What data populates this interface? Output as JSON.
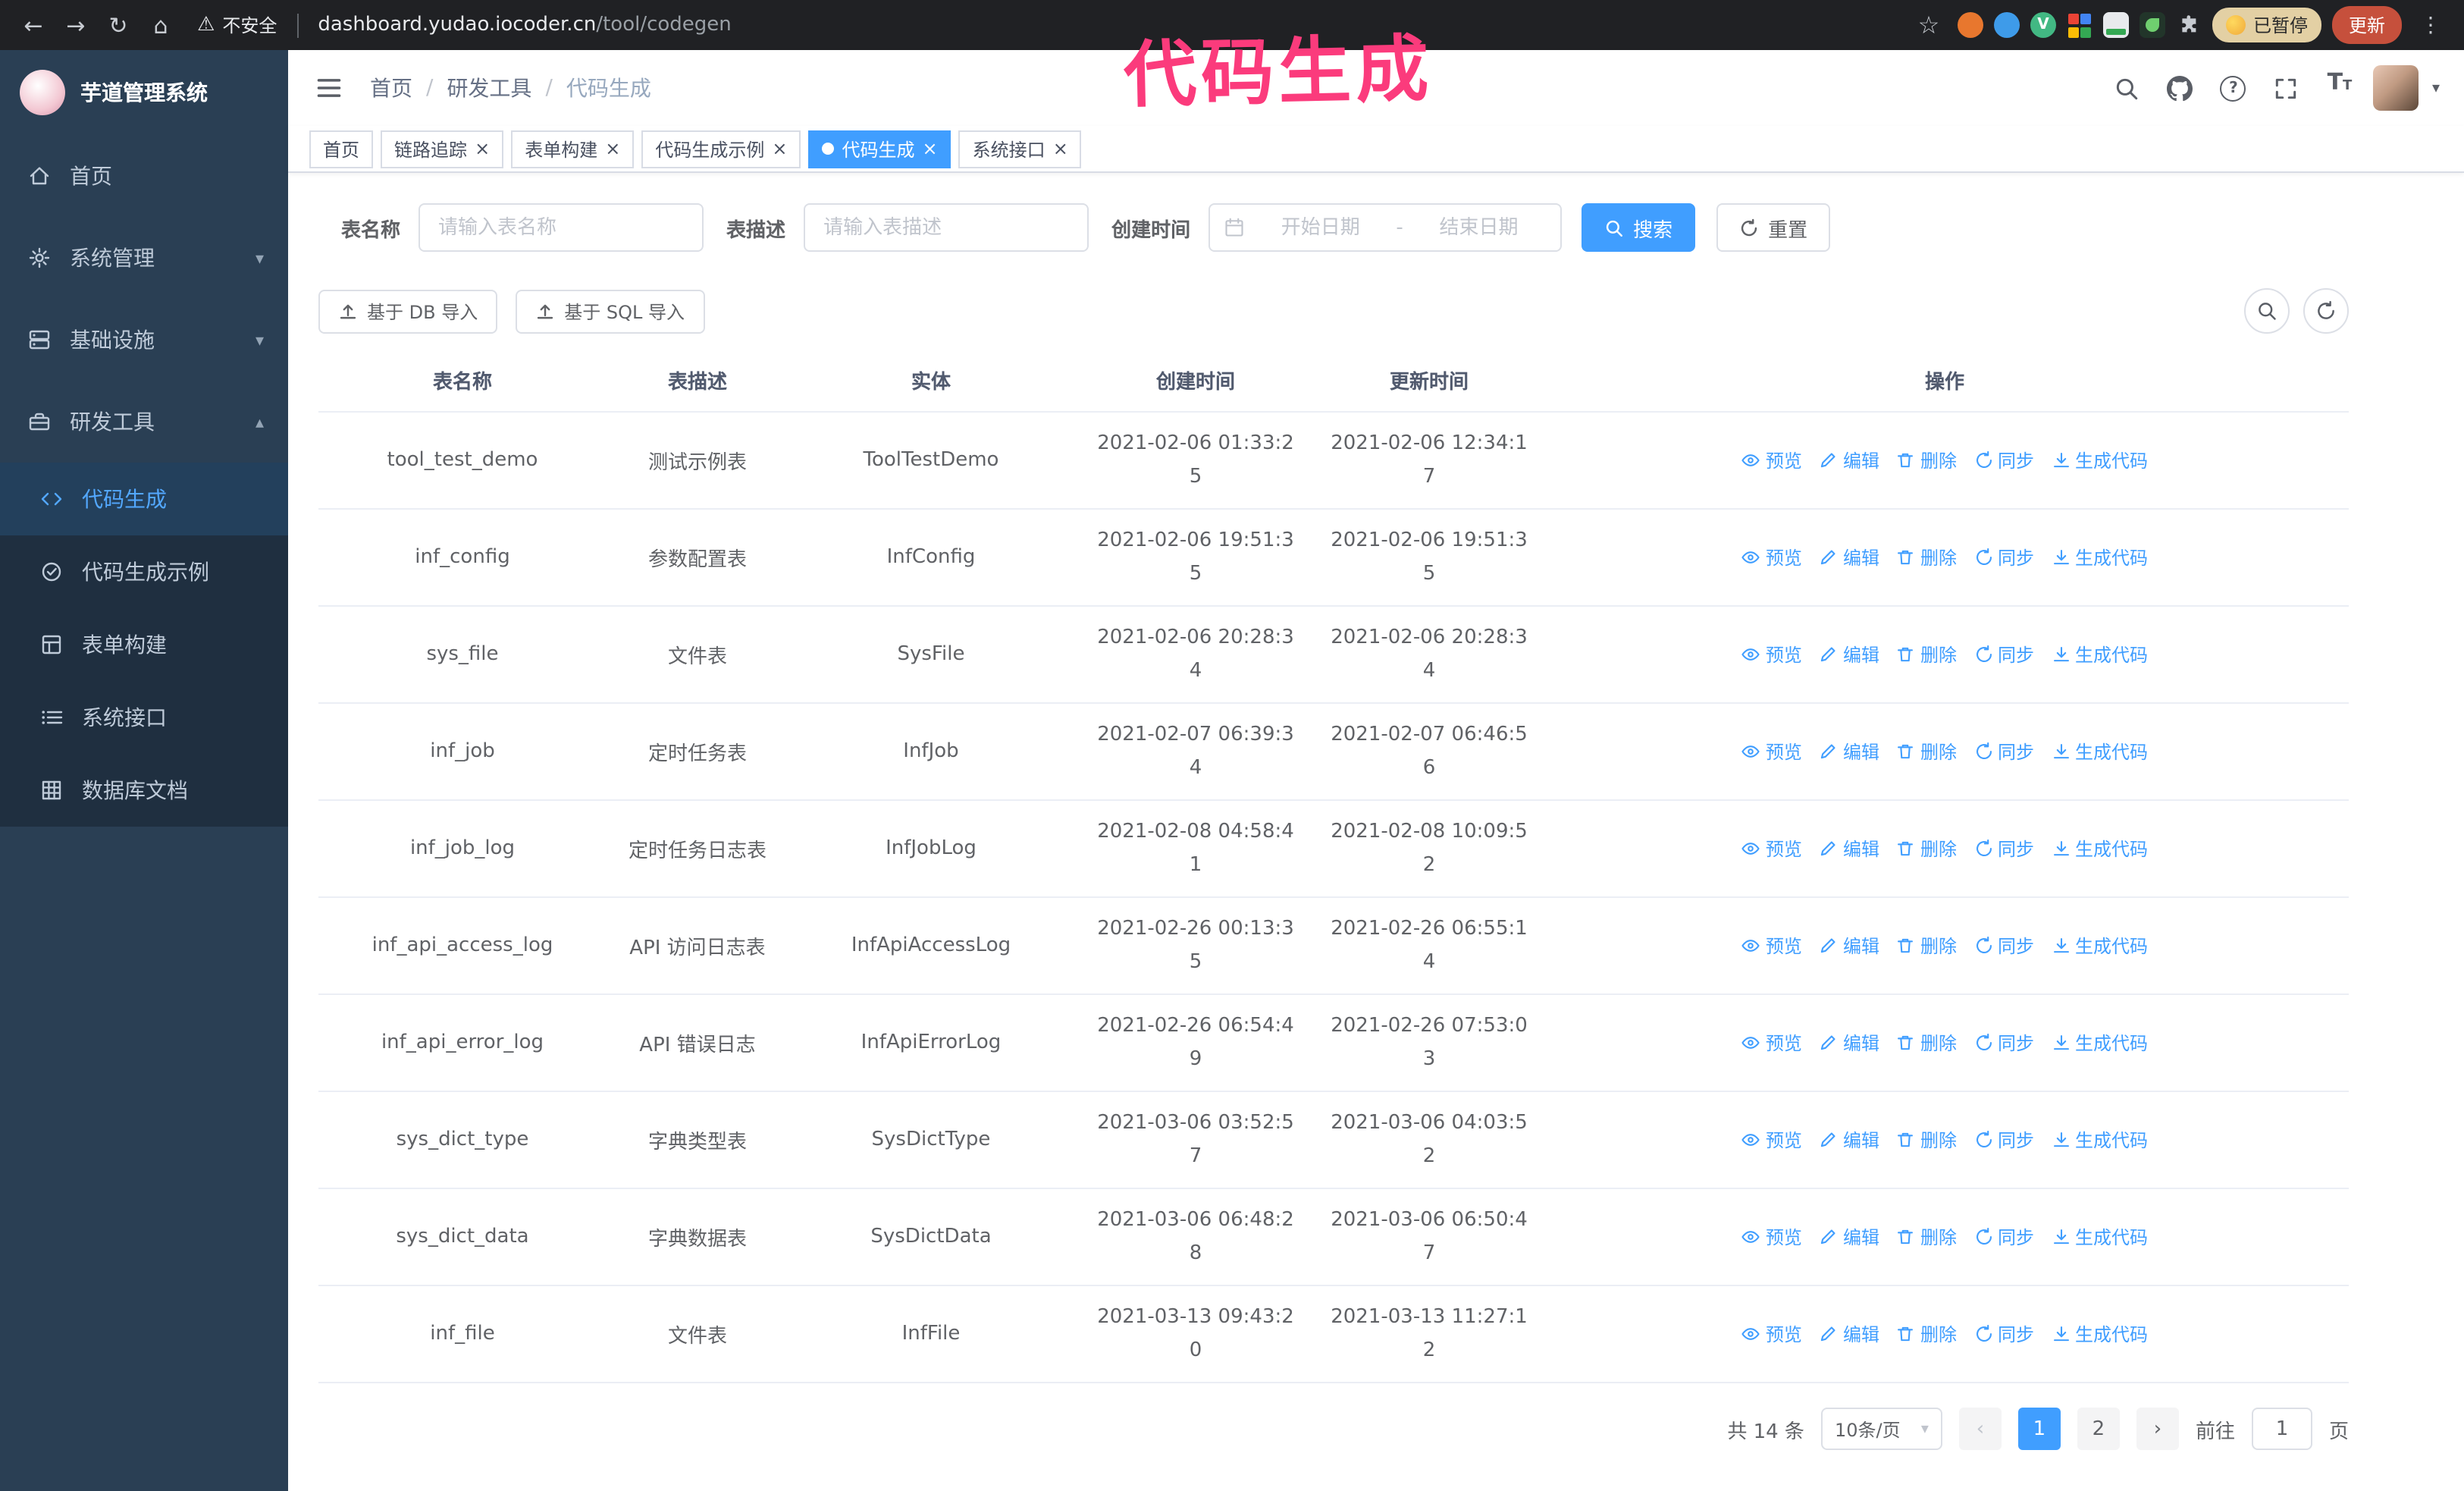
{
  "colors": {
    "primary": "#409EFF",
    "sidebar_bg": "#2a3f54",
    "submenu_bg": "#1f2f40",
    "chrome_bg": "#202124",
    "annotation_pink": "#fb3b7c",
    "update_button_bg": "#c6503c"
  },
  "annotation": {
    "text": "代码生成"
  },
  "icons": {
    "back": "←",
    "forward": "→",
    "reload": "↻",
    "home": "⌂",
    "warning": "⚠",
    "star": "☆",
    "kebab": "⋮",
    "close": "×",
    "caret_down": "▾",
    "caret_up": "▴",
    "select_caret": "▾",
    "prev": "‹",
    "next": "›",
    "question": "?",
    "font_size": "T",
    "vue_ext": "V",
    "avatar_caret": "▾"
  },
  "browser": {
    "security_label": "不安全",
    "url_host": "dashboard.yudao.iocoder.cn",
    "url_path": "/tool/codegen",
    "paused_badge": "已暂停",
    "update_button": "更新"
  },
  "sidebar": {
    "logo_title": "芋道管理系统",
    "items": [
      {
        "label": "首页"
      },
      {
        "label": "系统管理"
      },
      {
        "label": "基础设施"
      },
      {
        "label": "研发工具"
      }
    ],
    "sub_items": [
      {
        "label": "代码生成",
        "active": true
      },
      {
        "label": "代码生成示例"
      },
      {
        "label": "表单构建"
      },
      {
        "label": "系统接口"
      },
      {
        "label": "数据库文档"
      }
    ]
  },
  "navbar": {
    "breadcrumb": [
      "首页",
      "研发工具",
      "代码生成"
    ],
    "separator": "/"
  },
  "tags": [
    {
      "label": "首页",
      "closable": false,
      "active": false
    },
    {
      "label": "链路追踪",
      "closable": true,
      "active": false
    },
    {
      "label": "表单构建",
      "closable": true,
      "active": false
    },
    {
      "label": "代码生成示例",
      "closable": true,
      "active": false
    },
    {
      "label": "代码生成",
      "closable": true,
      "active": true
    },
    {
      "label": "系统接口",
      "closable": true,
      "active": false
    }
  ],
  "search_form": {
    "table_name_label": "表名称",
    "table_name_placeholder": "请输入表名称",
    "table_desc_label": "表描述",
    "table_desc_placeholder": "请输入表描述",
    "create_time_label": "创建时间",
    "date_start_placeholder": "开始日期",
    "date_separator": "-",
    "date_end_placeholder": "结束日期",
    "search_button": "搜索",
    "reset_button": "重置"
  },
  "toolbar": {
    "import_db_button": "基于 DB 导入",
    "import_sql_button": "基于 SQL 导入"
  },
  "table": {
    "columns": [
      "表名称",
      "表描述",
      "实体",
      "创建时间",
      "更新时间",
      "操作"
    ],
    "actions": [
      {
        "id": "preview",
        "label": "预览",
        "icon": "eye-icon"
      },
      {
        "id": "edit",
        "label": "编辑",
        "icon": "edit-icon"
      },
      {
        "id": "delete",
        "label": "删除",
        "icon": "delete-icon"
      },
      {
        "id": "sync",
        "label": "同步",
        "icon": "sync-icon"
      },
      {
        "id": "generate",
        "label": "生成代码",
        "icon": "download-icon"
      }
    ],
    "rows": [
      {
        "name": "tool_test_demo",
        "desc": "测试示例表",
        "entity": "ToolTestDemo",
        "create_time": "2021-02-06 01:33:25",
        "update_time": "2021-02-06 12:34:17"
      },
      {
        "name": "inf_config",
        "desc": "参数配置表",
        "entity": "InfConfig",
        "create_time": "2021-02-06 19:51:35",
        "update_time": "2021-02-06 19:51:35"
      },
      {
        "name": "sys_file",
        "desc": "文件表",
        "entity": "SysFile",
        "create_time": "2021-02-06 20:28:34",
        "update_time": "2021-02-06 20:28:34"
      },
      {
        "name": "inf_job",
        "desc": "定时任务表",
        "entity": "InfJob",
        "create_time": "2021-02-07 06:39:34",
        "update_time": "2021-02-07 06:46:56"
      },
      {
        "name": "inf_job_log",
        "desc": "定时任务日志表",
        "entity": "InfJobLog",
        "create_time": "2021-02-08 04:58:41",
        "update_time": "2021-02-08 10:09:52"
      },
      {
        "name": "inf_api_access_log",
        "desc": "API 访问日志表",
        "entity": "InfApiAccessLog",
        "create_time": "2021-02-26 00:13:35",
        "update_time": "2021-02-26 06:55:14"
      },
      {
        "name": "inf_api_error_log",
        "desc": "API 错误日志",
        "entity": "InfApiErrorLog",
        "create_time": "2021-02-26 06:54:49",
        "update_time": "2021-02-26 07:53:03"
      },
      {
        "name": "sys_dict_type",
        "desc": "字典类型表",
        "entity": "SysDictType",
        "create_time": "2021-03-06 03:52:57",
        "update_time": "2021-03-06 04:03:52"
      },
      {
        "name": "sys_dict_data",
        "desc": "字典数据表",
        "entity": "SysDictData",
        "create_time": "2021-03-06 06:48:28",
        "update_time": "2021-03-06 06:50:47"
      },
      {
        "name": "inf_file",
        "desc": "文件表",
        "entity": "InfFile",
        "create_time": "2021-03-13 09:43:20",
        "update_time": "2021-03-13 11:27:12"
      }
    ]
  },
  "pagination": {
    "total_label": "共 14 条",
    "page_size": "10条/页",
    "pages": [
      "1",
      "2"
    ],
    "active_page": "1",
    "goto_label": "前往",
    "goto_value": "1",
    "goto_suffix": "页"
  }
}
